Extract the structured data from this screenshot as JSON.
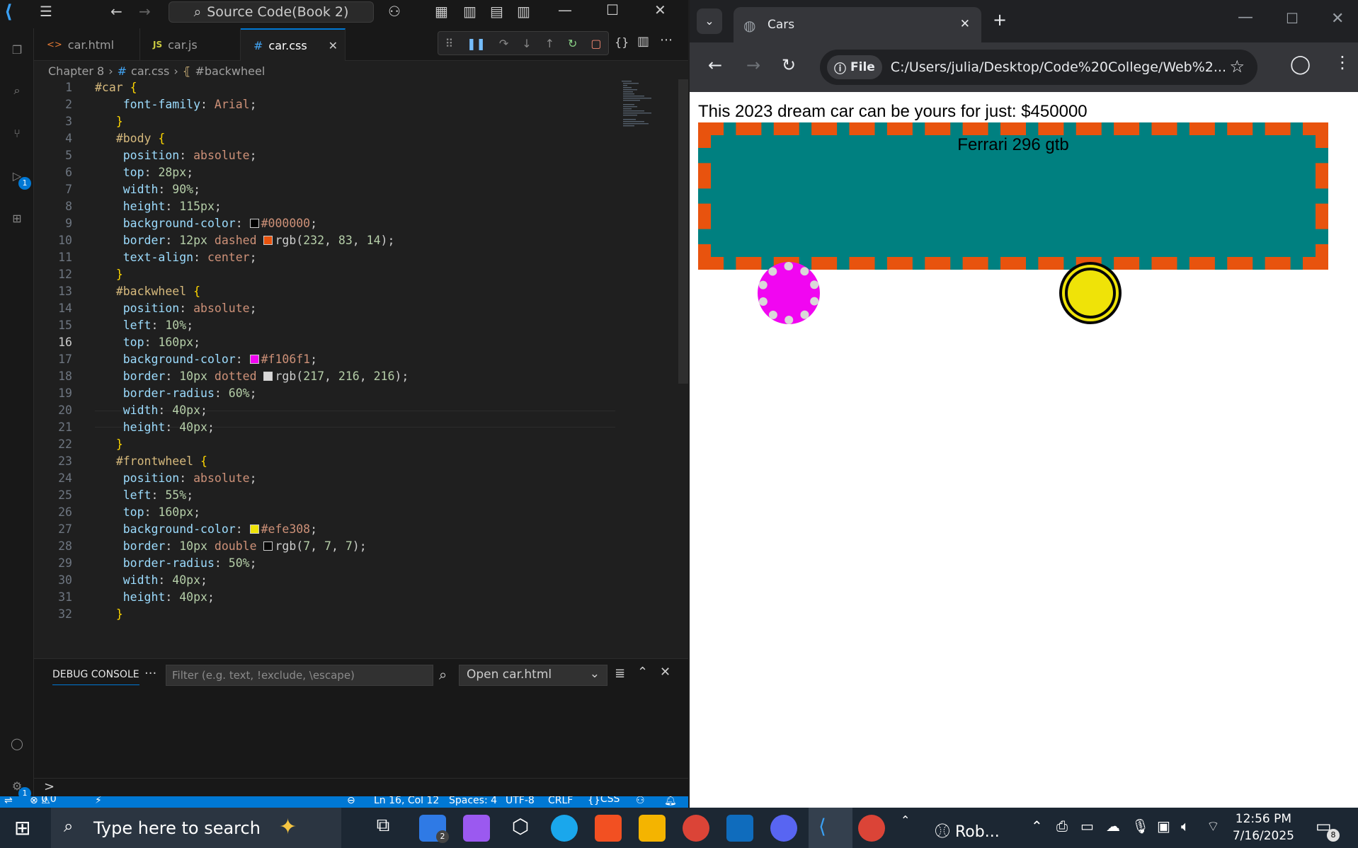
{
  "vscode": {
    "command_center": "Source Code(Book 2)",
    "tabs": [
      {
        "icon": "<>",
        "label": "car.html"
      },
      {
        "icon": "JS",
        "label": "car.js"
      },
      {
        "icon": "#",
        "label": "car.css"
      }
    ],
    "breadcrumb": {
      "folder": "Chapter 8",
      "file": "car.css",
      "symbol": "#backwheel"
    },
    "activity_badges": {
      "run": "1",
      "settings": "1"
    },
    "current_line": 16,
    "lines": [
      {
        "n": "1",
        "t": [
          [
            "sel",
            "#car "
          ],
          [
            "br",
            "{"
          ]
        ]
      },
      {
        "n": "2",
        "t": [
          [
            "pun",
            "    "
          ],
          [
            "prop",
            "font-family"
          ],
          [
            "pun",
            ": "
          ],
          [
            "val",
            "Arial"
          ],
          [
            "pun",
            ";"
          ]
        ]
      },
      {
        "n": "3",
        "t": [
          [
            "pun",
            "   "
          ],
          [
            "br",
            "}"
          ]
        ]
      },
      {
        "n": "4",
        "t": [
          [
            "pun",
            "   "
          ],
          [
            "sel",
            "#body "
          ],
          [
            "br",
            "{"
          ]
        ]
      },
      {
        "n": "5",
        "t": [
          [
            "pun",
            "    "
          ],
          [
            "prop",
            "position"
          ],
          [
            "pun",
            ": "
          ],
          [
            "val",
            "absolute"
          ],
          [
            "pun",
            ";"
          ]
        ]
      },
      {
        "n": "6",
        "t": [
          [
            "pun",
            "    "
          ],
          [
            "prop",
            "top"
          ],
          [
            "pun",
            ": "
          ],
          [
            "num",
            "28px"
          ],
          [
            "pun",
            ";"
          ]
        ]
      },
      {
        "n": "7",
        "t": [
          [
            "pun",
            "    "
          ],
          [
            "prop",
            "width"
          ],
          [
            "pun",
            ": "
          ],
          [
            "num",
            "90%"
          ],
          [
            "pun",
            ";"
          ]
        ]
      },
      {
        "n": "8",
        "t": [
          [
            "pun",
            "    "
          ],
          [
            "prop",
            "height"
          ],
          [
            "pun",
            ": "
          ],
          [
            "num",
            "115px"
          ],
          [
            "pun",
            ";"
          ]
        ]
      },
      {
        "n": "9",
        "t": [
          [
            "pun",
            "    "
          ],
          [
            "prop",
            "background-color"
          ],
          [
            "pun",
            ": "
          ],
          [
            "sw",
            "#000000"
          ],
          [
            "val",
            "#000000"
          ],
          [
            "pun",
            ";"
          ]
        ]
      },
      {
        "n": "10",
        "t": [
          [
            "pun",
            "    "
          ],
          [
            "prop",
            "border"
          ],
          [
            "pun",
            ": "
          ],
          [
            "num",
            "12px "
          ],
          [
            "val",
            "dashed "
          ],
          [
            "sw",
            "rgb(232,83,14)"
          ],
          [
            "pun",
            "rgb("
          ],
          [
            "num",
            "232"
          ],
          [
            "pun",
            ", "
          ],
          [
            "num",
            "83"
          ],
          [
            "pun",
            ", "
          ],
          [
            "num",
            "14"
          ],
          [
            "pun",
            ");"
          ]
        ]
      },
      {
        "n": "11",
        "t": [
          [
            "pun",
            "    "
          ],
          [
            "prop",
            "text-align"
          ],
          [
            "pun",
            ": "
          ],
          [
            "val",
            "center"
          ],
          [
            "pun",
            ";"
          ]
        ]
      },
      {
        "n": "12",
        "t": [
          [
            "pun",
            "   "
          ],
          [
            "br",
            "}"
          ]
        ]
      },
      {
        "n": "13",
        "t": [
          [
            "pun",
            "   "
          ],
          [
            "sel",
            "#backwheel "
          ],
          [
            "br",
            "{"
          ]
        ]
      },
      {
        "n": "14",
        "t": [
          [
            "pun",
            "    "
          ],
          [
            "prop",
            "position"
          ],
          [
            "pun",
            ": "
          ],
          [
            "val",
            "absolute"
          ],
          [
            "pun",
            ";"
          ]
        ]
      },
      {
        "n": "15",
        "t": [
          [
            "pun",
            "    "
          ],
          [
            "prop",
            "left"
          ],
          [
            "pun",
            ": "
          ],
          [
            "num",
            "10%"
          ],
          [
            "pun",
            ";"
          ]
        ]
      },
      {
        "n": "16",
        "t": [
          [
            "pun",
            "    "
          ],
          [
            "prop",
            "top"
          ],
          [
            "pun",
            ": "
          ],
          [
            "num",
            "160px"
          ],
          [
            "pun",
            ";"
          ]
        ]
      },
      {
        "n": "17",
        "t": [
          [
            "pun",
            "    "
          ],
          [
            "prop",
            "background-color"
          ],
          [
            "pun",
            ": "
          ],
          [
            "sw",
            "#f106f1"
          ],
          [
            "val",
            "#f106f1"
          ],
          [
            "pun",
            ";"
          ]
        ]
      },
      {
        "n": "18",
        "t": [
          [
            "pun",
            "    "
          ],
          [
            "prop",
            "border"
          ],
          [
            "pun",
            ": "
          ],
          [
            "num",
            "10px "
          ],
          [
            "val",
            "dotted "
          ],
          [
            "sw",
            "rgb(217,216,216)"
          ],
          [
            "pun",
            "rgb("
          ],
          [
            "num",
            "217"
          ],
          [
            "pun",
            ", "
          ],
          [
            "num",
            "216"
          ],
          [
            "pun",
            ", "
          ],
          [
            "num",
            "216"
          ],
          [
            "pun",
            ");"
          ]
        ]
      },
      {
        "n": "19",
        "t": [
          [
            "pun",
            "    "
          ],
          [
            "prop",
            "border-radius"
          ],
          [
            "pun",
            ": "
          ],
          [
            "num",
            "60%"
          ],
          [
            "pun",
            ";"
          ]
        ]
      },
      {
        "n": "20",
        "t": [
          [
            "pun",
            "    "
          ],
          [
            "prop",
            "width"
          ],
          [
            "pun",
            ": "
          ],
          [
            "num",
            "40px"
          ],
          [
            "pun",
            ";"
          ]
        ]
      },
      {
        "n": "21",
        "t": [
          [
            "pun",
            "    "
          ],
          [
            "prop",
            "height"
          ],
          [
            "pun",
            ": "
          ],
          [
            "num",
            "40px"
          ],
          [
            "pun",
            ";"
          ]
        ]
      },
      {
        "n": "22",
        "t": [
          [
            "pun",
            "   "
          ],
          [
            "br",
            "}"
          ]
        ]
      },
      {
        "n": "23",
        "t": [
          [
            "pun",
            "   "
          ],
          [
            "sel",
            "#frontwheel "
          ],
          [
            "br",
            "{"
          ]
        ]
      },
      {
        "n": "24",
        "t": [
          [
            "pun",
            "    "
          ],
          [
            "prop",
            "position"
          ],
          [
            "pun",
            ": "
          ],
          [
            "val",
            "absolute"
          ],
          [
            "pun",
            ";"
          ]
        ]
      },
      {
        "n": "25",
        "t": [
          [
            "pun",
            "    "
          ],
          [
            "prop",
            "left"
          ],
          [
            "pun",
            ": "
          ],
          [
            "num",
            "55%"
          ],
          [
            "pun",
            ";"
          ]
        ]
      },
      {
        "n": "26",
        "t": [
          [
            "pun",
            "    "
          ],
          [
            "prop",
            "top"
          ],
          [
            "pun",
            ": "
          ],
          [
            "num",
            "160px"
          ],
          [
            "pun",
            ";"
          ]
        ]
      },
      {
        "n": "27",
        "t": [
          [
            "pun",
            "    "
          ],
          [
            "prop",
            "background-color"
          ],
          [
            "pun",
            ": "
          ],
          [
            "sw",
            "#efe308"
          ],
          [
            "val",
            "#efe308"
          ],
          [
            "pun",
            ";"
          ]
        ]
      },
      {
        "n": "28",
        "t": [
          [
            "pun",
            "    "
          ],
          [
            "prop",
            "border"
          ],
          [
            "pun",
            ": "
          ],
          [
            "num",
            "10px "
          ],
          [
            "val",
            "double "
          ],
          [
            "sw",
            "rgb(7,7,7)"
          ],
          [
            "pun",
            "rgb("
          ],
          [
            "num",
            "7"
          ],
          [
            "pun",
            ", "
          ],
          [
            "num",
            "7"
          ],
          [
            "pun",
            ", "
          ],
          [
            "num",
            "7"
          ],
          [
            "pun",
            ");"
          ]
        ]
      },
      {
        "n": "29",
        "t": [
          [
            "pun",
            "    "
          ],
          [
            "prop",
            "border-radius"
          ],
          [
            "pun",
            ": "
          ],
          [
            "num",
            "50%"
          ],
          [
            "pun",
            ";"
          ]
        ]
      },
      {
        "n": "30",
        "t": [
          [
            "pun",
            "    "
          ],
          [
            "prop",
            "width"
          ],
          [
            "pun",
            ": "
          ],
          [
            "num",
            "40px"
          ],
          [
            "pun",
            ";"
          ]
        ]
      },
      {
        "n": "31",
        "t": [
          [
            "pun",
            "    "
          ],
          [
            "prop",
            "height"
          ],
          [
            "pun",
            ": "
          ],
          [
            "num",
            "40px"
          ],
          [
            "pun",
            ";"
          ]
        ]
      },
      {
        "n": "32",
        "t": [
          [
            "pun",
            "   "
          ],
          [
            "br",
            "}"
          ]
        ]
      }
    ],
    "panel": {
      "tab": "DEBUG CONSOLE",
      "more": "···",
      "filter_placeholder": "Filter (e.g. text, !exclude, \\escape)",
      "launch": "Open car.html",
      "prompt": ">"
    },
    "status": {
      "errors": "0",
      "warnings": "0",
      "position": "Ln 16, Col 12",
      "spaces": "Spaces: 4",
      "encoding": "UTF-8",
      "eol": "CRLF",
      "language": "CSS"
    }
  },
  "browser": {
    "tab_title": "Cars",
    "chip": "File",
    "url": "C:/Users/julia/Desktop/Code%20College/Web%2...",
    "page": {
      "headline": "This 2023 dream car can be yours for just: $450000",
      "car_name": "Ferrari 296 gtb"
    }
  },
  "taskbar": {
    "search_placeholder": "Type here to search",
    "mail_badge": "2",
    "app_label": "Rob...",
    "time": "12:56 PM",
    "date": "7/16/2025",
    "notif_count": "8"
  },
  "colors": {
    "accent": "#0078d4",
    "body_bg": "#008080",
    "body_border": "#e8530e",
    "backwheel": "#f106f1",
    "frontwheel": "#efe308"
  }
}
